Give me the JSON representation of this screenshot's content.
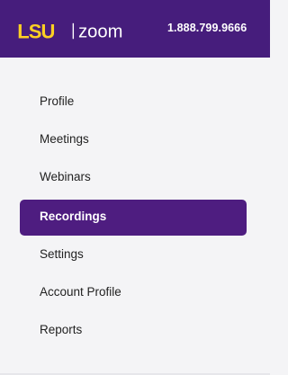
{
  "header": {
    "brand_left": "LSU",
    "brand_right": "zoom",
    "phone": "1.888.799.9666",
    "colors": {
      "background": "#461d7c",
      "lsu_gold": "#fdd023",
      "white": "#ffffff"
    }
  },
  "nav": {
    "items": [
      {
        "label": "Profile",
        "active": false
      },
      {
        "label": "Meetings",
        "active": false
      },
      {
        "label": "Webinars",
        "active": false
      },
      {
        "label": "Recordings",
        "active": true
      },
      {
        "label": "Settings",
        "active": false
      },
      {
        "label": "Account Profile",
        "active": false
      },
      {
        "label": "Reports",
        "active": false
      }
    ],
    "active_color": "#4e1d80"
  }
}
